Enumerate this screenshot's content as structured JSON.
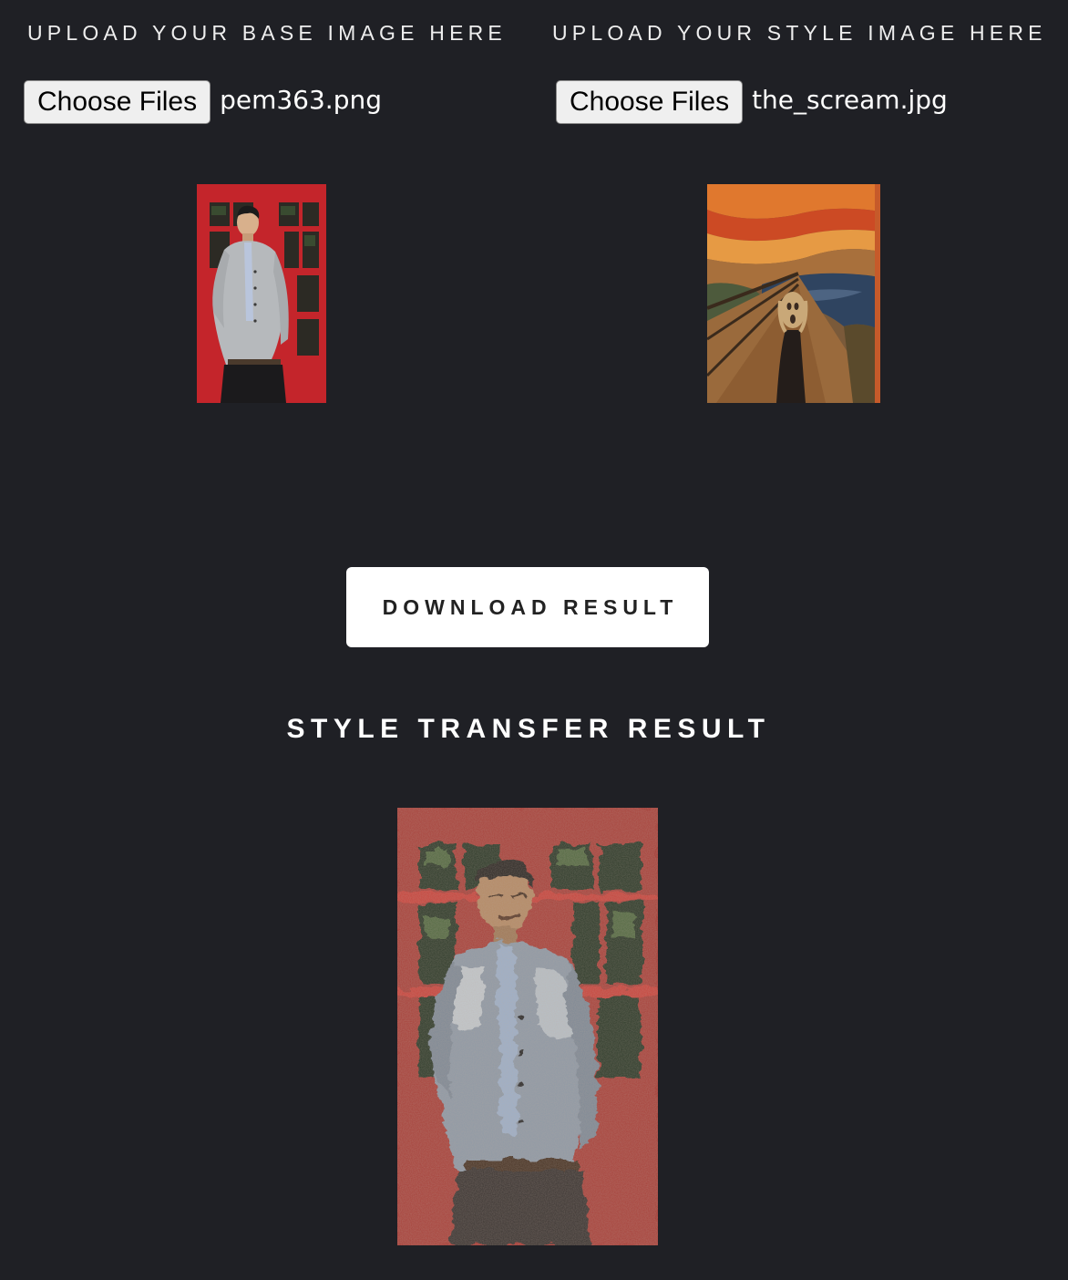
{
  "base_upload": {
    "heading": "UPLOAD YOUR BASE IMAGE HERE",
    "button_label": "Choose Files",
    "file_name": "pem363.png"
  },
  "style_upload": {
    "heading": "UPLOAD YOUR STYLE IMAGE HERE",
    "button_label": "Choose Files",
    "file_name": "the_scream.jpg"
  },
  "download": {
    "label": "DOWNLOAD RESULT"
  },
  "result": {
    "title": "STYLE TRANSFER RESULT"
  },
  "colors": {
    "background": "#1f2025",
    "button_bg": "#ffffff",
    "heading_text": "#eeeeee"
  }
}
